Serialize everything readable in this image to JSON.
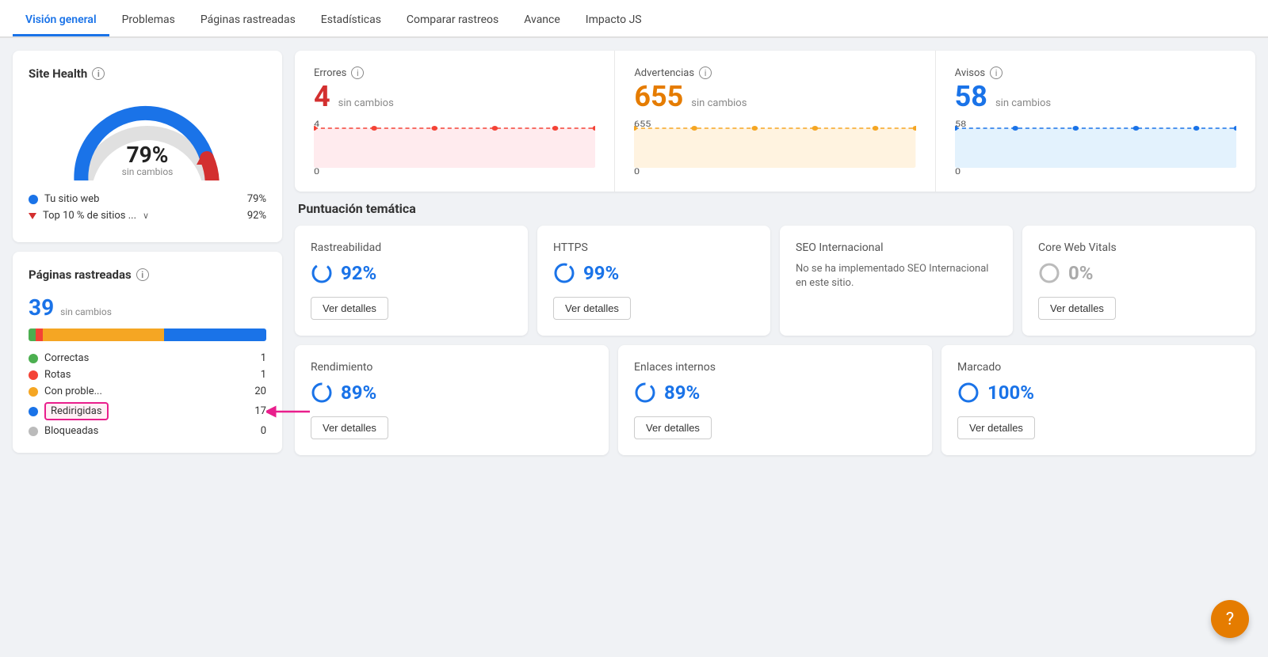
{
  "nav": {
    "items": [
      {
        "label": "Visión general",
        "active": true
      },
      {
        "label": "Problemas",
        "active": false
      },
      {
        "label": "Páginas rastreadas",
        "active": false
      },
      {
        "label": "Estadísticas",
        "active": false
      },
      {
        "label": "Comparar rastreos",
        "active": false
      },
      {
        "label": "Avance",
        "active": false
      },
      {
        "label": "Impacto JS",
        "active": false
      }
    ]
  },
  "sidebar": {
    "site_health": {
      "title": "Site Health",
      "percent": "79%",
      "sub": "sin cambios",
      "legend": [
        {
          "label": "Tu sitio web",
          "value": "79%",
          "type": "dot",
          "color": "#1a73e8"
        },
        {
          "label": "Top 10 % de sitios ...",
          "value": "92%",
          "type": "triangle",
          "color": "#d32f2f"
        }
      ]
    },
    "pages": {
      "title": "Páginas rastreadas",
      "count": "39",
      "sub": "sin cambios",
      "bar": [
        {
          "color": "#4caf50",
          "pct": 3
        },
        {
          "color": "#f44336",
          "pct": 3
        },
        {
          "color": "#f5a623",
          "pct": 51
        },
        {
          "color": "#1a73e8",
          "pct": 43
        }
      ],
      "legend": [
        {
          "label": "Correctas",
          "value": "1",
          "color": "#4caf50",
          "highlighted": false
        },
        {
          "label": "Rotas",
          "value": "1",
          "color": "#f44336",
          "highlighted": false
        },
        {
          "label": "Con proble...",
          "value": "20",
          "color": "#f5a623",
          "highlighted": false
        },
        {
          "label": "Redirigidas",
          "value": "17",
          "color": "#1a73e8",
          "highlighted": true
        },
        {
          "label": "Bloqueadas",
          "value": "0",
          "color": "#bbb",
          "highlighted": false
        }
      ]
    }
  },
  "metrics": [
    {
      "label": "Errores",
      "value": "4",
      "color": "red",
      "change": "sin cambios",
      "chart_color": "#ffcdd2",
      "line_color": "#f44336",
      "y_top": "4",
      "y_bot": "0"
    },
    {
      "label": "Advertencias",
      "value": "655",
      "color": "orange",
      "change": "sin cambios",
      "chart_color": "#ffe0b2",
      "line_color": "#f5a623",
      "y_top": "655",
      "y_bot": "0"
    },
    {
      "label": "Avisos",
      "value": "58",
      "color": "blue",
      "change": "sin cambios",
      "chart_color": "#e3f2fd",
      "line_color": "#1a73e8",
      "y_top": "58",
      "y_bot": "0"
    }
  ],
  "thematic": {
    "title": "Puntuación temática",
    "row1": [
      {
        "title": "Rastreabilidad",
        "pct": "92%",
        "color": "blue",
        "btn": "Ver detalles"
      },
      {
        "title": "HTTPS",
        "pct": "99%",
        "color": "blue",
        "btn": "Ver detalles"
      },
      {
        "title": "SEO Internacional",
        "pct": null,
        "color": "blue",
        "btn": null,
        "note": "No se ha implementado SEO Internacional en este sitio."
      },
      {
        "title": "Core Web Vitals",
        "pct": "0%",
        "color": "gray",
        "btn": "Ver detalles"
      }
    ],
    "row2": [
      {
        "title": "Rendimiento",
        "pct": "89%",
        "color": "blue",
        "btn": "Ver detalles"
      },
      {
        "title": "Enlaces internos",
        "pct": "89%",
        "color": "blue",
        "btn": "Ver detalles"
      },
      {
        "title": "Marcado",
        "pct": "100%",
        "color": "blue",
        "btn": "Ver detalles"
      }
    ]
  },
  "fab": "?"
}
